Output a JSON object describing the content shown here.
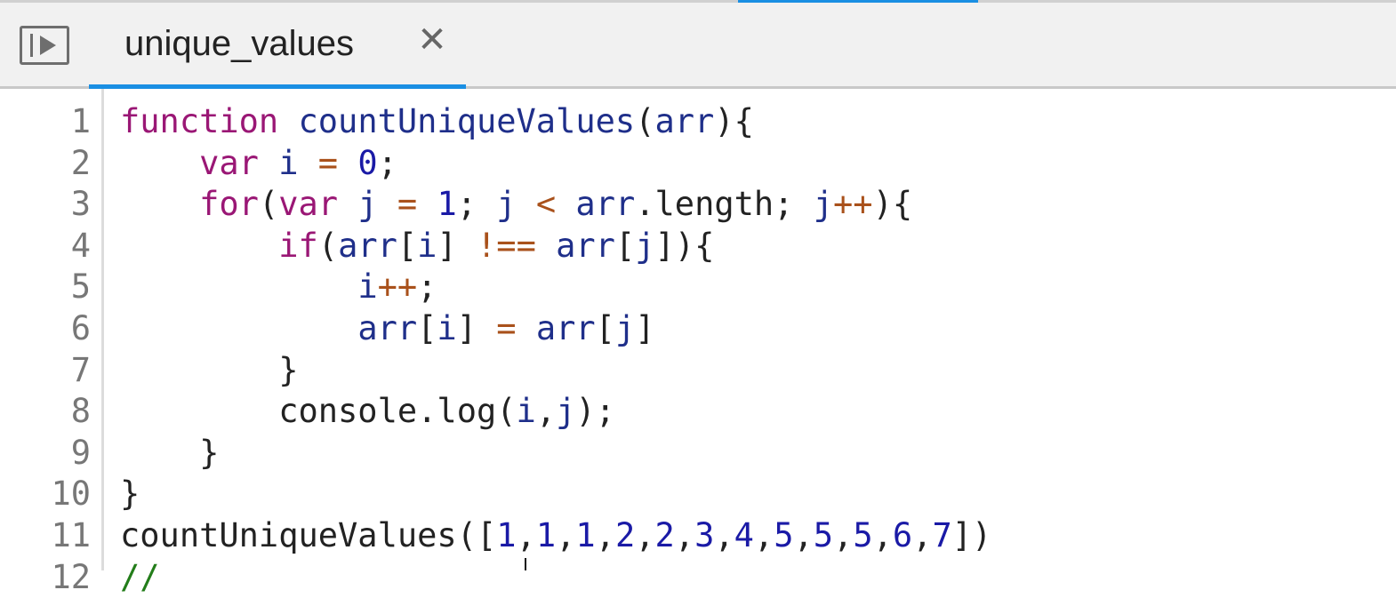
{
  "tab": {
    "title": "unique_values",
    "close_glyph": "✕"
  },
  "icons": [
    "panel-toggle-icon",
    "close-icon"
  ],
  "colors": {
    "accent": "#1a8fe3",
    "keyword": "#9a1775",
    "identifier": "#1f2f8a",
    "number": "#1a1aa6",
    "operator": "#a9511b",
    "comment": "#237d1a"
  },
  "editor": {
    "line_numbers": [
      "1",
      "2",
      "3",
      "4",
      "5",
      "6",
      "7",
      "8",
      "9",
      "10",
      "11",
      "12"
    ],
    "lines": [
      [
        {
          "t": "kw",
          "v": "function"
        },
        {
          "t": "tx",
          "v": " "
        },
        {
          "t": "fn",
          "v": "countUniqueValues"
        },
        {
          "t": "tx",
          "v": "("
        },
        {
          "t": "vr",
          "v": "arr"
        },
        {
          "t": "tx",
          "v": "){"
        }
      ],
      [
        {
          "t": "tx",
          "v": "    "
        },
        {
          "t": "kw",
          "v": "var"
        },
        {
          "t": "tx",
          "v": " "
        },
        {
          "t": "vr",
          "v": "i"
        },
        {
          "t": "tx",
          "v": " "
        },
        {
          "t": "op",
          "v": "="
        },
        {
          "t": "tx",
          "v": " "
        },
        {
          "t": "nm",
          "v": "0"
        },
        {
          "t": "tx",
          "v": ";"
        }
      ],
      [
        {
          "t": "tx",
          "v": "    "
        },
        {
          "t": "kw",
          "v": "for"
        },
        {
          "t": "tx",
          "v": "("
        },
        {
          "t": "kw",
          "v": "var"
        },
        {
          "t": "tx",
          "v": " "
        },
        {
          "t": "vr",
          "v": "j"
        },
        {
          "t": "tx",
          "v": " "
        },
        {
          "t": "op",
          "v": "="
        },
        {
          "t": "tx",
          "v": " "
        },
        {
          "t": "nm",
          "v": "1"
        },
        {
          "t": "tx",
          "v": "; "
        },
        {
          "t": "vr",
          "v": "j"
        },
        {
          "t": "tx",
          "v": " "
        },
        {
          "t": "op",
          "v": "<"
        },
        {
          "t": "tx",
          "v": " "
        },
        {
          "t": "vr",
          "v": "arr"
        },
        {
          "t": "tx",
          "v": ".length; "
        },
        {
          "t": "vr",
          "v": "j"
        },
        {
          "t": "op",
          "v": "++"
        },
        {
          "t": "tx",
          "v": "){"
        }
      ],
      [
        {
          "t": "tx",
          "v": "        "
        },
        {
          "t": "kw",
          "v": "if"
        },
        {
          "t": "tx",
          "v": "("
        },
        {
          "t": "vr",
          "v": "arr"
        },
        {
          "t": "tx",
          "v": "["
        },
        {
          "t": "vr",
          "v": "i"
        },
        {
          "t": "tx",
          "v": "] "
        },
        {
          "t": "op",
          "v": "!=="
        },
        {
          "t": "tx",
          "v": " "
        },
        {
          "t": "vr",
          "v": "arr"
        },
        {
          "t": "tx",
          "v": "["
        },
        {
          "t": "vr",
          "v": "j"
        },
        {
          "t": "tx",
          "v": "]){"
        }
      ],
      [
        {
          "t": "tx",
          "v": "            "
        },
        {
          "t": "vr",
          "v": "i"
        },
        {
          "t": "op",
          "v": "++"
        },
        {
          "t": "tx",
          "v": ";"
        }
      ],
      [
        {
          "t": "tx",
          "v": "            "
        },
        {
          "t": "vr",
          "v": "arr"
        },
        {
          "t": "tx",
          "v": "["
        },
        {
          "t": "vr",
          "v": "i"
        },
        {
          "t": "tx",
          "v": "] "
        },
        {
          "t": "op",
          "v": "="
        },
        {
          "t": "tx",
          "v": " "
        },
        {
          "t": "vr",
          "v": "arr"
        },
        {
          "t": "tx",
          "v": "["
        },
        {
          "t": "vr",
          "v": "j"
        },
        {
          "t": "tx",
          "v": "]"
        }
      ],
      [
        {
          "t": "tx",
          "v": "        }"
        }
      ],
      [
        {
          "t": "tx",
          "v": "        console.log("
        },
        {
          "t": "vr",
          "v": "i"
        },
        {
          "t": "tx",
          "v": ","
        },
        {
          "t": "vr",
          "v": "j"
        },
        {
          "t": "tx",
          "v": ");"
        }
      ],
      [
        {
          "t": "tx",
          "v": "    }"
        }
      ],
      [
        {
          "t": "tx",
          "v": "}"
        }
      ],
      [
        {
          "t": "tx",
          "v": "countUniqueValues(["
        },
        {
          "t": "nm",
          "v": "1"
        },
        {
          "t": "tx",
          "v": ","
        },
        {
          "t": "nm",
          "v": "1"
        },
        {
          "t": "tx",
          "v": ","
        },
        {
          "t": "nm",
          "v": "1"
        },
        {
          "t": "tx",
          "v": ","
        },
        {
          "t": "nm",
          "v": "2"
        },
        {
          "t": "tx",
          "v": ","
        },
        {
          "t": "nm",
          "v": "2"
        },
        {
          "t": "tx",
          "v": ","
        },
        {
          "t": "nm",
          "v": "3"
        },
        {
          "t": "tx",
          "v": ","
        },
        {
          "t": "nm",
          "v": "4"
        },
        {
          "t": "tx",
          "v": ","
        },
        {
          "t": "nm",
          "v": "5"
        },
        {
          "t": "tx",
          "v": ","
        },
        {
          "t": "nm",
          "v": "5"
        },
        {
          "t": "tx",
          "v": ","
        },
        {
          "t": "nm",
          "v": "5"
        },
        {
          "t": "tx",
          "v": ","
        },
        {
          "t": "nm",
          "v": "6"
        },
        {
          "t": "tx",
          "v": ","
        },
        {
          "t": "nm",
          "v": "7"
        },
        {
          "t": "tx",
          "v": "])"
        }
      ],
      [
        {
          "t": "cm",
          "v": "//"
        }
      ]
    ]
  }
}
